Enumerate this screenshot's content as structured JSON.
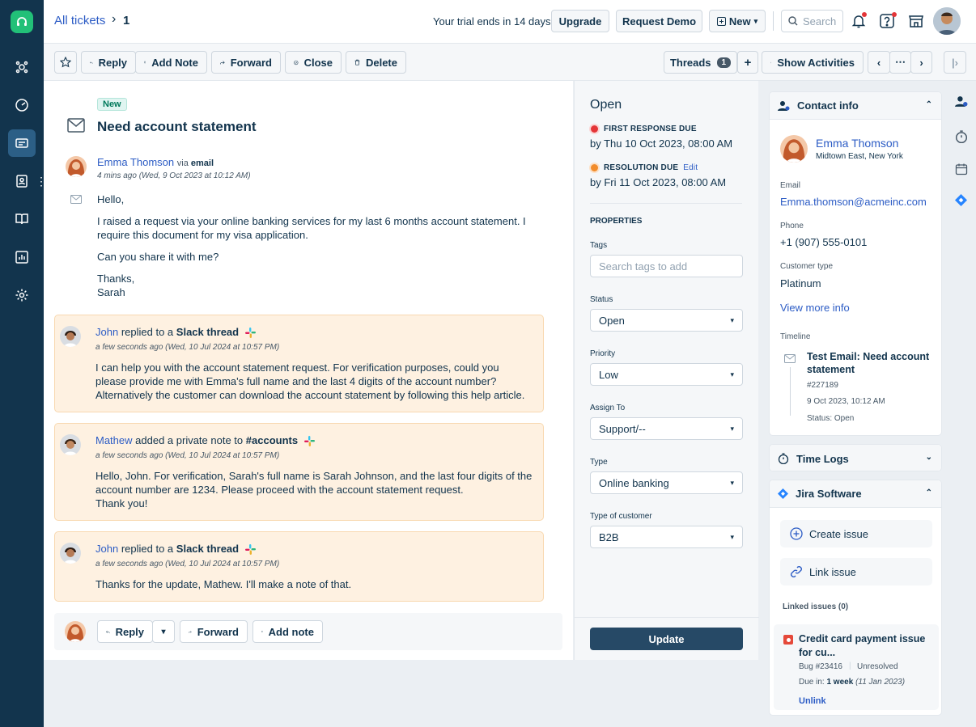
{
  "topbar": {
    "breadcrumb": "All tickets",
    "ticket_number": "1",
    "trial_text": "Your trial ends in 14 days",
    "upgrade": "Upgrade",
    "request_demo": "Request Demo",
    "new": "New",
    "search_placeholder": "Search"
  },
  "toolbar": {
    "reply": "Reply",
    "add_note": "Add Note",
    "forward": "Forward",
    "close": "Close",
    "delete": "Delete",
    "threads": "Threads",
    "threads_count": "1",
    "show_activities": "Show Activities"
  },
  "ticket": {
    "tag": "New",
    "subject": "Need account statement",
    "sender_name": "Emma Thomson",
    "via": "via",
    "channel": "email",
    "sent_time": "4 mins ago (Wed, 9 Oct 2023 at 10:12 AM)",
    "body": {
      "l1": "Hello,",
      "l2": "I raised a request via your online banking services for my last 6 months account statement. I require this document for my visa application.",
      "l3": "Can you share it with me?",
      "l4": "Thanks,",
      "l5": "Sarah"
    }
  },
  "notes": [
    {
      "author": "John",
      "action": "replied to a",
      "target": "Slack thread",
      "time": "a few seconds ago (Wed, 10 Jul 2024 at 10:57 PM)",
      "text": "I can help you with the account statement request. For verification purposes, could you please provide me with Emma's full name and the last 4 digits of the account number? Alternatively the customer can download the account statement by following this help article."
    },
    {
      "author": "Mathew",
      "action": "added a private note to",
      "target": "#accounts",
      "time": "a few seconds ago (Wed, 10 Jul 2024 at 10:57 PM)",
      "text1": "Hello, John. For verification, Sarah's full name is Sarah Johnson, and the last four digits of the account number are 1234. Please proceed with the account statement request.",
      "text2": "Thank you!"
    },
    {
      "author": "John",
      "action": "replied to a",
      "target": "Slack thread",
      "time": "a few seconds ago (Wed, 10 Jul 2024 at 10:57 PM)",
      "text": "Thanks for the update, Mathew. I'll make a note of that."
    }
  ],
  "reply_bar": {
    "reply": "Reply",
    "forward": "Forward",
    "add_note": "Add note"
  },
  "properties": {
    "status_heading": "Open",
    "first_response_label": "FIRST RESPONSE DUE",
    "first_response_value": "by Thu 10 Oct 2023, 08:00 AM",
    "resolution_label": "RESOLUTION DUE",
    "resolution_edit": "Edit",
    "resolution_value": "by Fri 11 Oct 2023, 08:00 AM",
    "section": "PROPERTIES",
    "tags_label": "Tags",
    "tags_placeholder": "Search tags to add",
    "status_label": "Status",
    "status_value": "Open",
    "priority_label": "Priority",
    "priority_value": "Low",
    "assign_label": "Assign To",
    "assign_value": "Support/--",
    "type_label": "Type",
    "type_value": "Online banking",
    "customer_type_label": "Type of customer",
    "customer_type_value": "B2B",
    "update": "Update"
  },
  "contact": {
    "header": "Contact info",
    "name": "Emma Thomson",
    "location": "Midtown East, New York",
    "email_label": "Email",
    "email": "Emma.thomson@acmeinc.com",
    "phone_label": "Phone",
    "phone": "+1 (907) 555-0101",
    "ctype_label": "Customer type",
    "ctype": "Platinum",
    "view_more": "View more info",
    "timeline_label": "Timeline",
    "timeline_title": "Test Email: Need account statement",
    "timeline_id": "#227189",
    "timeline_date": "9 Oct 2023, 10:12 AM",
    "timeline_status": "Status: Open"
  },
  "time_logs": {
    "header": "Time Logs"
  },
  "jira": {
    "header": "Jira Software",
    "create": "Create issue",
    "link": "Link issue",
    "linked": "Linked issues (0)",
    "issue_title": "Credit card payment issue for cu...",
    "issue_id": "Bug #23416",
    "issue_status": "Unresolved",
    "due_label": "Due in:",
    "due_value": "1 week",
    "due_date": "(11 Jan 2023)",
    "unlink": "Unlink"
  },
  "colors": {
    "sidebar": "#12344d",
    "accent": "#2c5cc5",
    "note_bg": "#fef1e1",
    "update_btn": "#264966",
    "first_response_dot": "#e43538",
    "resolution_dot": "#f28c2b"
  }
}
